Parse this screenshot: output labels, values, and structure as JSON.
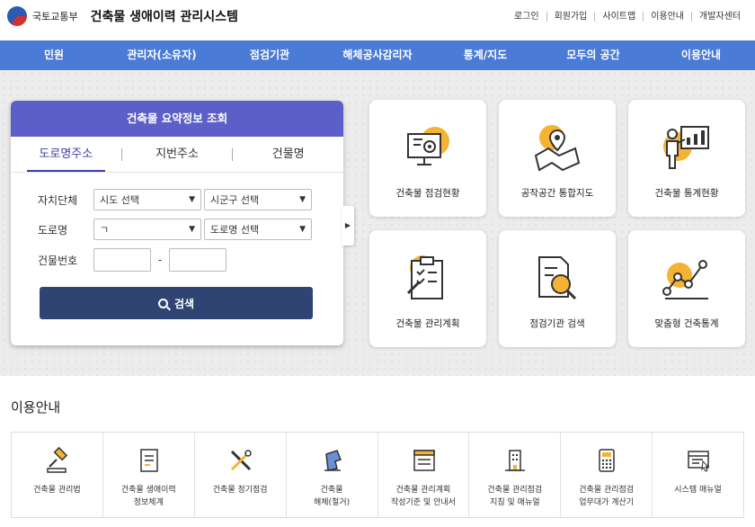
{
  "header": {
    "ministry": "국토교통부",
    "system_title": "건축물 생애이력 관리시스템",
    "util_links": [
      "로그인",
      "회원가입",
      "사이트맵",
      "이용안내",
      "개발자센터"
    ]
  },
  "nav": [
    "민원",
    "관리자(소유자)",
    "점검기관",
    "해체공사감리자",
    "통계/지도",
    "모두의 공간",
    "이용안내"
  ],
  "search": {
    "title": "건축물 요약정보 조회",
    "tabs": [
      "도로명주소",
      "지번주소",
      "건물명"
    ],
    "active_tab": "도로명주소",
    "region_label": "자치단체",
    "sido_select": "시도 선택",
    "sigungu_select": "시군구 선택",
    "road_label": "도로명",
    "initial_select": "ㄱ",
    "road_select": "도로명 선택",
    "building_no_label": "건물번호",
    "dash": "-",
    "button": "검색"
  },
  "tiles": [
    {
      "label": "건축물 점검현황",
      "icon": "monitor-gear-icon"
    },
    {
      "label": "공작공간 통합지도",
      "icon": "map-pin-icon"
    },
    {
      "label": "건축물 통계현황",
      "icon": "presenter-chart-icon"
    },
    {
      "label": "건축물 관리계획",
      "icon": "clipboard-pen-icon"
    },
    {
      "label": "점검기관 검색",
      "icon": "document-search-icon"
    },
    {
      "label": "맞춤형 건축통계",
      "icon": "line-graph-icon"
    }
  ],
  "guide": {
    "title": "이용안내",
    "items": [
      {
        "label": "건축물 관리법",
        "icon": "gavel-icon"
      },
      {
        "label": "건축물 생애이력\n정보체계",
        "icon": "document-icon"
      },
      {
        "label": "건축물 정기점검",
        "icon": "tools-icon"
      },
      {
        "label": "건축물\n해체(철거)",
        "icon": "demolition-icon"
      },
      {
        "label": "건축물 관리계획\n작성기준 및 안내서",
        "icon": "form-icon"
      },
      {
        "label": "건축물 관리점검\n지침 및 매뉴얼",
        "icon": "building-icon"
      },
      {
        "label": "건축물 관리점검\n업무대가 계산기",
        "icon": "calculator-icon"
      },
      {
        "label": "시스템 매뉴얼",
        "icon": "manual-window-icon"
      }
    ]
  },
  "colors": {
    "nav": "#4a7bd6",
    "card_header": "#5b5fc7",
    "button": "#2f4472",
    "accent": "#f5b335"
  }
}
